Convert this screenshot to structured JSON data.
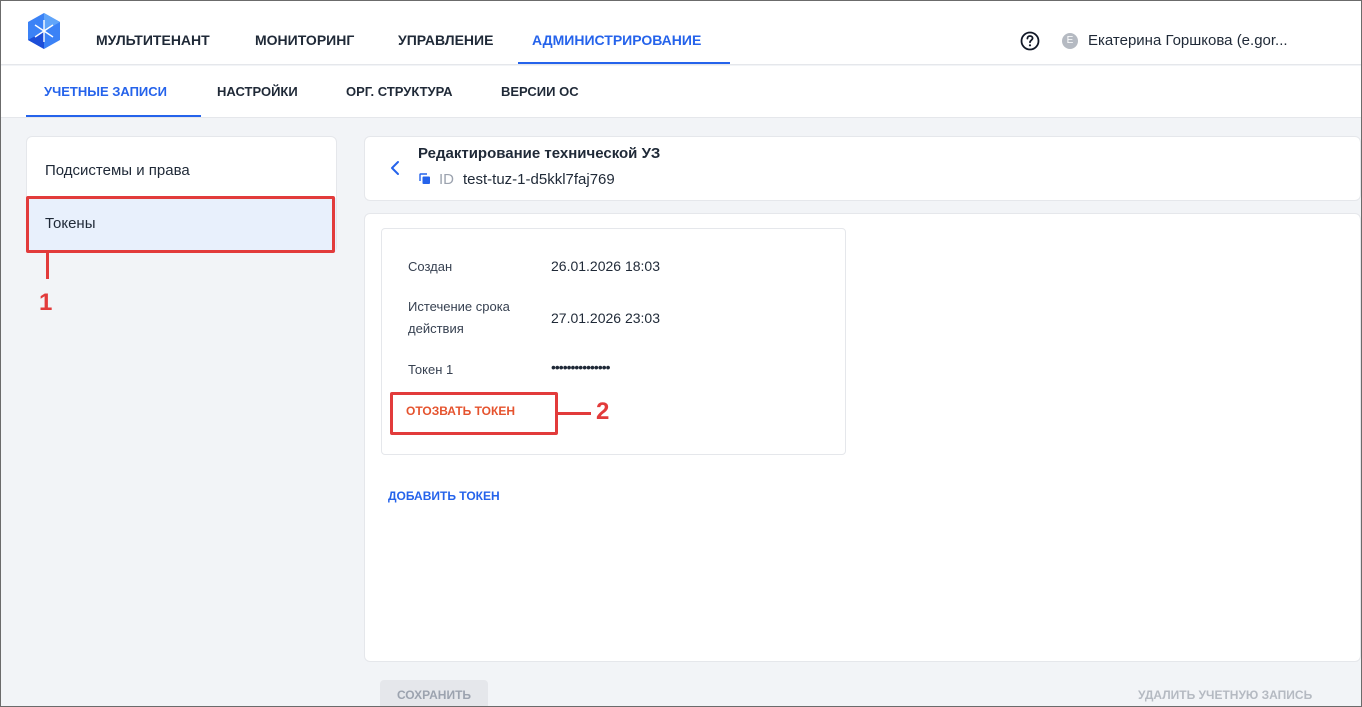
{
  "colors": {
    "accent": "#2563eb",
    "danger": "#e5532e",
    "annotation": "#e23b3b",
    "selected_bg": "#e8f0fc"
  },
  "topnav": {
    "items": [
      {
        "label": "МУЛЬТИТЕНАНТ",
        "active": false
      },
      {
        "label": "МОНИТОРИНГ",
        "active": false
      },
      {
        "label": "УПРАВЛЕНИЕ",
        "active": false
      },
      {
        "label": "АДМИНИСТРИРОВАНИЕ",
        "active": true
      }
    ],
    "help_icon": "question-circle-icon",
    "avatar_letter": "E",
    "user_name": "Екатерина Горшкова (e.gor..."
  },
  "subnav": {
    "items": [
      {
        "label": "УЧЕТНЫЕ ЗАПИСИ",
        "active": true
      },
      {
        "label": "НАСТРОЙКИ",
        "active": false
      },
      {
        "label": "ОРГ. СТРУКТУРА",
        "active": false
      },
      {
        "label": "ВЕРСИИ ОС",
        "active": false
      }
    ]
  },
  "sidebar": {
    "items": [
      {
        "label": "Подсистемы и права",
        "active": false
      },
      {
        "label": "Токены",
        "active": true
      }
    ]
  },
  "header": {
    "title": "Редактирование технической УЗ",
    "id_label": "ID",
    "id_value": "test-tuz-1-d5kkl7faj769"
  },
  "token": {
    "created_label": "Создан",
    "created_value": "26.01.2026 18:03",
    "expires_label_line1": "Истечение срока",
    "expires_label_line2": "действия",
    "expires_value": "27.01.2026 23:03",
    "token_label": "Токен 1",
    "token_value": "•••••••••••••••",
    "revoke_label": "ОТОЗВАТЬ ТОКЕН"
  },
  "add_token_label": "ДОБАВИТЬ ТОКЕН",
  "footer": {
    "save_label": "СОХРАНИТЬ",
    "delete_label": "УДАЛИТЬ УЧЕТНУЮ ЗАПИСЬ"
  },
  "annotations": {
    "marker_1": "1",
    "marker_2": "2"
  }
}
